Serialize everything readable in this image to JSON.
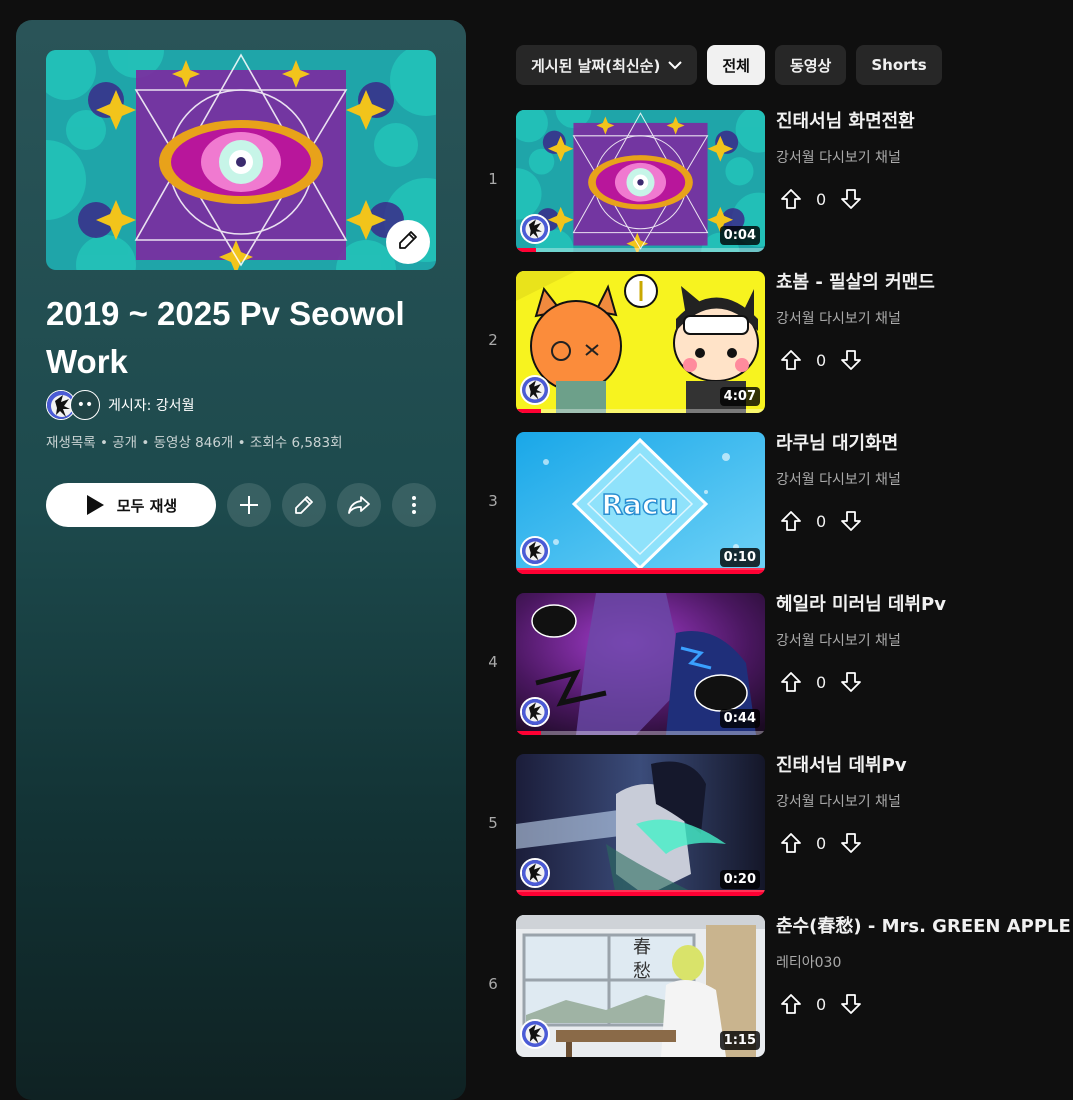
{
  "playlist": {
    "title": "2019 ~ 2025 Pv Seowol Work",
    "owner_text": "게시자: 강서월",
    "avatar_more": "••",
    "meta": "재생목록 • 공개 • 동영상 846개 • 조회수 6,583회",
    "play_all_label": "모두 재생"
  },
  "filters": {
    "sort_label": "게시된 날짜(최신순)",
    "chips": [
      "전체",
      "동영상",
      "Shorts"
    ],
    "active_chip": "전체"
  },
  "videos": [
    {
      "index": "1",
      "title": "진태서님 화면전환",
      "channel": "강서월 다시보기 채널",
      "duration": "0:04",
      "likes": "0",
      "progress": 0.08
    },
    {
      "index": "2",
      "title": "쵸봄 - 필살의 커맨드",
      "channel": "강서월 다시보기 채널",
      "duration": "4:07",
      "likes": "0",
      "progress": 0.1
    },
    {
      "index": "3",
      "title": "라쿠님 대기화면",
      "channel": "강서월 다시보기 채널",
      "duration": "0:10",
      "likes": "0",
      "progress": 1.0
    },
    {
      "index": "4",
      "title": "헤일라 미러님 데뷔Pv",
      "channel": "강서월 다시보기 채널",
      "duration": "0:44",
      "likes": "0",
      "progress": 0.1
    },
    {
      "index": "5",
      "title": "진태서님 데뷔Pv",
      "channel": "강서월 다시보기 채널",
      "duration": "0:20",
      "likes": "0",
      "progress": 1.0
    },
    {
      "index": "6",
      "title": "춘수(春愁) - Mrs. GREEN APPLE | C",
      "channel": "레티아030",
      "duration": "1:15",
      "likes": "0",
      "progress": 0
    }
  ],
  "thumb6_text": [
    "春",
    "愁"
  ],
  "thumb3_text": "Racu",
  "icons": [
    "pencil-icon",
    "play-icon",
    "plus-icon",
    "share-icon",
    "more-vert-icon",
    "chevron-down-icon",
    "thumb-up-outline-icon",
    "thumb-down-outline-icon"
  ],
  "colors": {
    "progress": "#ff0033",
    "panel_top": "#2a5458",
    "panel_bottom": "#0f2223"
  }
}
